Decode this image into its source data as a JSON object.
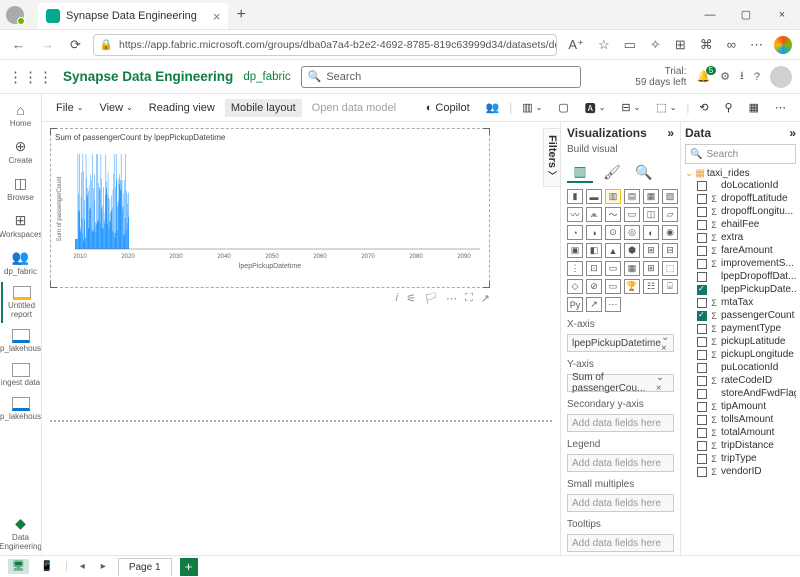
{
  "browser": {
    "tab_title": "Synapse Data Engineering",
    "url": "https://app.fabric.microsoft.com/groups/dba0a7a4-b2e2-4692-8785-819c63999d34/datasets/dc915ecc-4cd7-4..."
  },
  "header": {
    "app_name": "Synapse Data Engineering",
    "workspace": "dp_fabric",
    "search_placeholder": "Search",
    "trial_line1": "Trial:",
    "trial_line2": "59 days left"
  },
  "leftnav": {
    "home": "Home",
    "create": "Create",
    "browse": "Browse",
    "workspaces": "Workspaces",
    "dp_fabric": "dp_fabric",
    "untitled": "Untitled report",
    "lake1": "dp_lakehouse",
    "ingest": "ingest data",
    "lake2": "dp_lakehouse",
    "de": "Data Engineering"
  },
  "toolbar": {
    "file": "File",
    "view": "View",
    "reading": "Reading view",
    "mobile": "Mobile layout",
    "open_model": "Open data model",
    "copilot": "Copilot"
  },
  "chart_data": {
    "type": "bar",
    "title": "Sum of passengerCount by lpepPickupDatetime",
    "xlabel": "lpepPickupDatetime",
    "ylabel": "Sum of passengerCount",
    "x_ticks": [
      "2010",
      "2020",
      "2030",
      "2040",
      "2050",
      "2060",
      "2070",
      "2080",
      "2090"
    ],
    "series": [
      {
        "name": "passengerCount",
        "note": "Dense spike cluster between ~2008 and ~2020; values elsewhere ~0. Peak relative height ~1.0, typical bars 0.1–0.9 of peak."
      }
    ]
  },
  "viz": {
    "title": "Visualizations",
    "sub": "Build visual",
    "xaxis_label": "X-axis",
    "xaxis_value": "lpepPickupDatetime",
    "yaxis_label": "Y-axis",
    "yaxis_value": "Sum of passengerCou...",
    "sec_y": "Secondary y-axis",
    "legend": "Legend",
    "small": "Small multiples",
    "tooltips": "Tooltips",
    "placeholder": "Add data fields here"
  },
  "data": {
    "title": "Data",
    "search": "Search",
    "table": "taxi_rides",
    "fields": [
      {
        "n": "doLocationId",
        "s": 0,
        "c": 0
      },
      {
        "n": "dropoffLatitude",
        "s": 1,
        "c": 0
      },
      {
        "n": "dropoffLongitu...",
        "s": 1,
        "c": 0
      },
      {
        "n": "ehailFee",
        "s": 1,
        "c": 0
      },
      {
        "n": "extra",
        "s": 1,
        "c": 0
      },
      {
        "n": "fareAmount",
        "s": 1,
        "c": 0
      },
      {
        "n": "improvementS...",
        "s": 1,
        "c": 0
      },
      {
        "n": "lpepDropoffDat...",
        "s": 0,
        "c": 0
      },
      {
        "n": "lpepPickupDate...",
        "s": 0,
        "c": 1
      },
      {
        "n": "mtaTax",
        "s": 1,
        "c": 0
      },
      {
        "n": "passengerCount",
        "s": 1,
        "c": 1
      },
      {
        "n": "paymentType",
        "s": 1,
        "c": 0
      },
      {
        "n": "pickupLatitude",
        "s": 1,
        "c": 0
      },
      {
        "n": "pickupLongitude",
        "s": 1,
        "c": 0
      },
      {
        "n": "puLocationId",
        "s": 0,
        "c": 0
      },
      {
        "n": "rateCodeID",
        "s": 1,
        "c": 0
      },
      {
        "n": "storeAndFwdFlag",
        "s": 0,
        "c": 0
      },
      {
        "n": "tipAmount",
        "s": 1,
        "c": 0
      },
      {
        "n": "tollsAmount",
        "s": 1,
        "c": 0
      },
      {
        "n": "totalAmount",
        "s": 1,
        "c": 0
      },
      {
        "n": "tripDistance",
        "s": 1,
        "c": 0
      },
      {
        "n": "tripType",
        "s": 1,
        "c": 0
      },
      {
        "n": "vendorID",
        "s": 1,
        "c": 0
      }
    ]
  },
  "footer": {
    "page": "Page 1"
  },
  "filters": "Filters"
}
